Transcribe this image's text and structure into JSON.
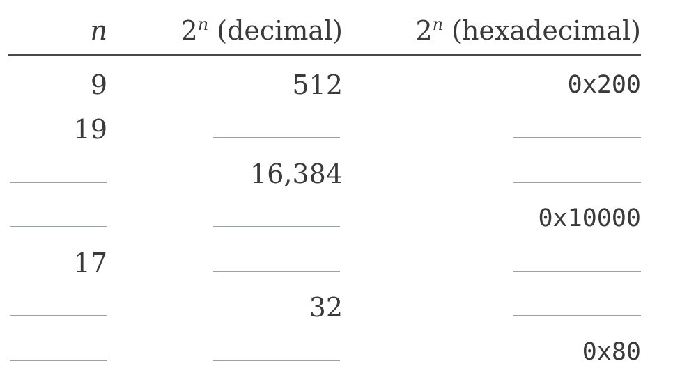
{
  "table": {
    "headers": {
      "n": "n",
      "decimal_base": "2",
      "decimal_exp": "n",
      "decimal_suffix": " (decimal)",
      "hex_base": "2",
      "hex_exp": "n",
      "hex_suffix": " (hexadecimal)"
    },
    "rows": [
      {
        "n": "9",
        "decimal": "512",
        "hex": "0x200"
      },
      {
        "n": "19",
        "decimal": "",
        "hex": ""
      },
      {
        "n": "",
        "decimal": "16,384",
        "hex": ""
      },
      {
        "n": "",
        "decimal": "",
        "hex": "0x10000"
      },
      {
        "n": "17",
        "decimal": "",
        "hex": ""
      },
      {
        "n": "",
        "decimal": "32",
        "hex": ""
      },
      {
        "n": "",
        "decimal": "",
        "hex": "0x80"
      }
    ]
  }
}
